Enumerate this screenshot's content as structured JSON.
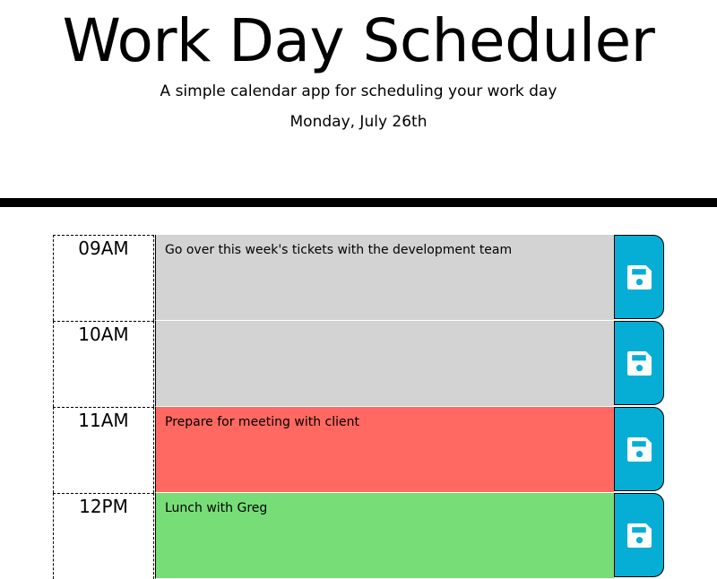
{
  "header": {
    "title": "Work Day Scheduler",
    "subtitle": "A simple calendar app for scheduling your work day",
    "current_day": "Monday, July 26th"
  },
  "colors": {
    "past": "#d3d3d3",
    "present": "#ff6961",
    "future": "#77dd77",
    "save_button": "#06aed5"
  },
  "time_blocks": [
    {
      "hour": "09AM",
      "description": "Go over this week's tickets with the development team",
      "state": "past",
      "save_icon": "floppy-disk-icon"
    },
    {
      "hour": "10AM",
      "description": "",
      "state": "past",
      "save_icon": "floppy-disk-icon"
    },
    {
      "hour": "11AM",
      "description": "Prepare for meeting with client",
      "state": "present",
      "save_icon": "floppy-disk-icon"
    },
    {
      "hour": "12PM",
      "description": "Lunch with Greg",
      "state": "future",
      "save_icon": "floppy-disk-icon"
    }
  ]
}
